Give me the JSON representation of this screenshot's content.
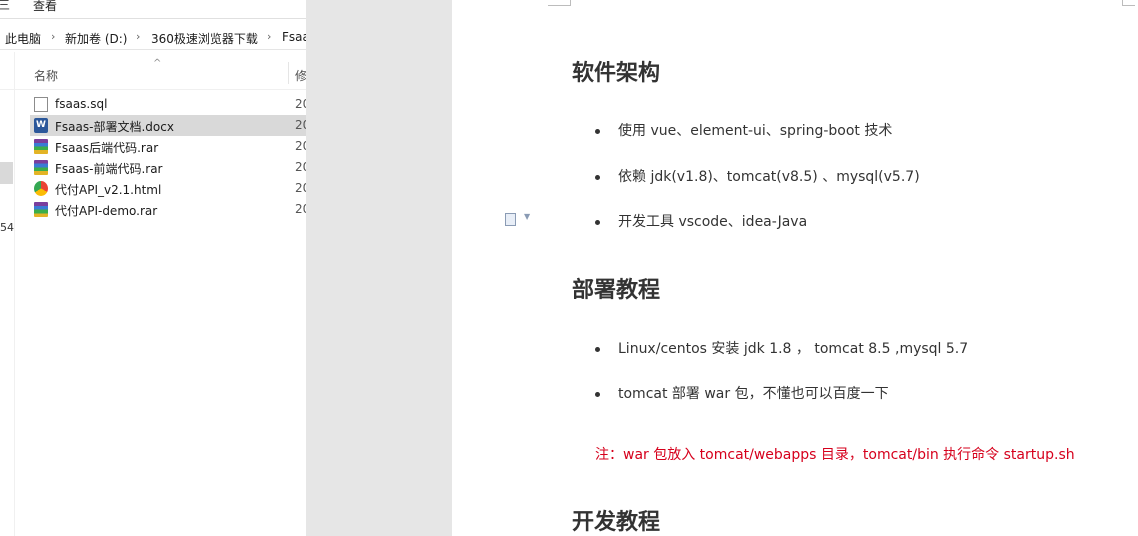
{
  "explorer": {
    "ribbon": {
      "glyph": "三",
      "view_tab": "查看"
    },
    "breadcrumb": [
      "此电脑",
      "新加卷 (D:)",
      "360极速浏览器下载",
      "Fsaa"
    ],
    "columns": {
      "name": "名称",
      "modified": "修"
    },
    "nav_number": "54",
    "files": [
      {
        "name": "fsaas.sql",
        "icon": "text-file-icon",
        "date": "20"
      },
      {
        "name": "Fsaas-部署文档.docx",
        "icon": "word-doc-icon",
        "date": "20",
        "selected": true
      },
      {
        "name": "Fsaas后端代码.rar",
        "icon": "rar-archive-icon",
        "date": "20"
      },
      {
        "name": "Fsaas-前端代码.rar",
        "icon": "rar-archive-icon",
        "date": "20"
      },
      {
        "name": "代付API_v2.1.html",
        "icon": "browser-html-icon",
        "date": "20"
      },
      {
        "name": "代付API-demo.rar",
        "icon": "rar-archive-icon",
        "date": "20"
      }
    ]
  },
  "document": {
    "section1": {
      "heading": "软件架构",
      "items": [
        "使用 vue、element-ui、spring-boot 技术",
        "依赖 jdk(v1.8)、tomcat(v8.5) 、mysql(v5.7)",
        "开发工具 vscode、idea-Java"
      ]
    },
    "section2": {
      "heading": "部署教程",
      "items": [
        "Linux/centos 安装 jdk 1.8 ， tomcat 8.5 ,mysql 5.7",
        "tomcat 部署 war 包，不懂也可以百度一下"
      ],
      "note": "注：war 包放入 tomcat/webapps 目录，tomcat/bin 执行命令 startup.sh"
    },
    "section3": {
      "heading": "开发教程"
    }
  },
  "colors": {
    "note_red": "#d6001c",
    "selected_row": "#d9d9d9"
  }
}
